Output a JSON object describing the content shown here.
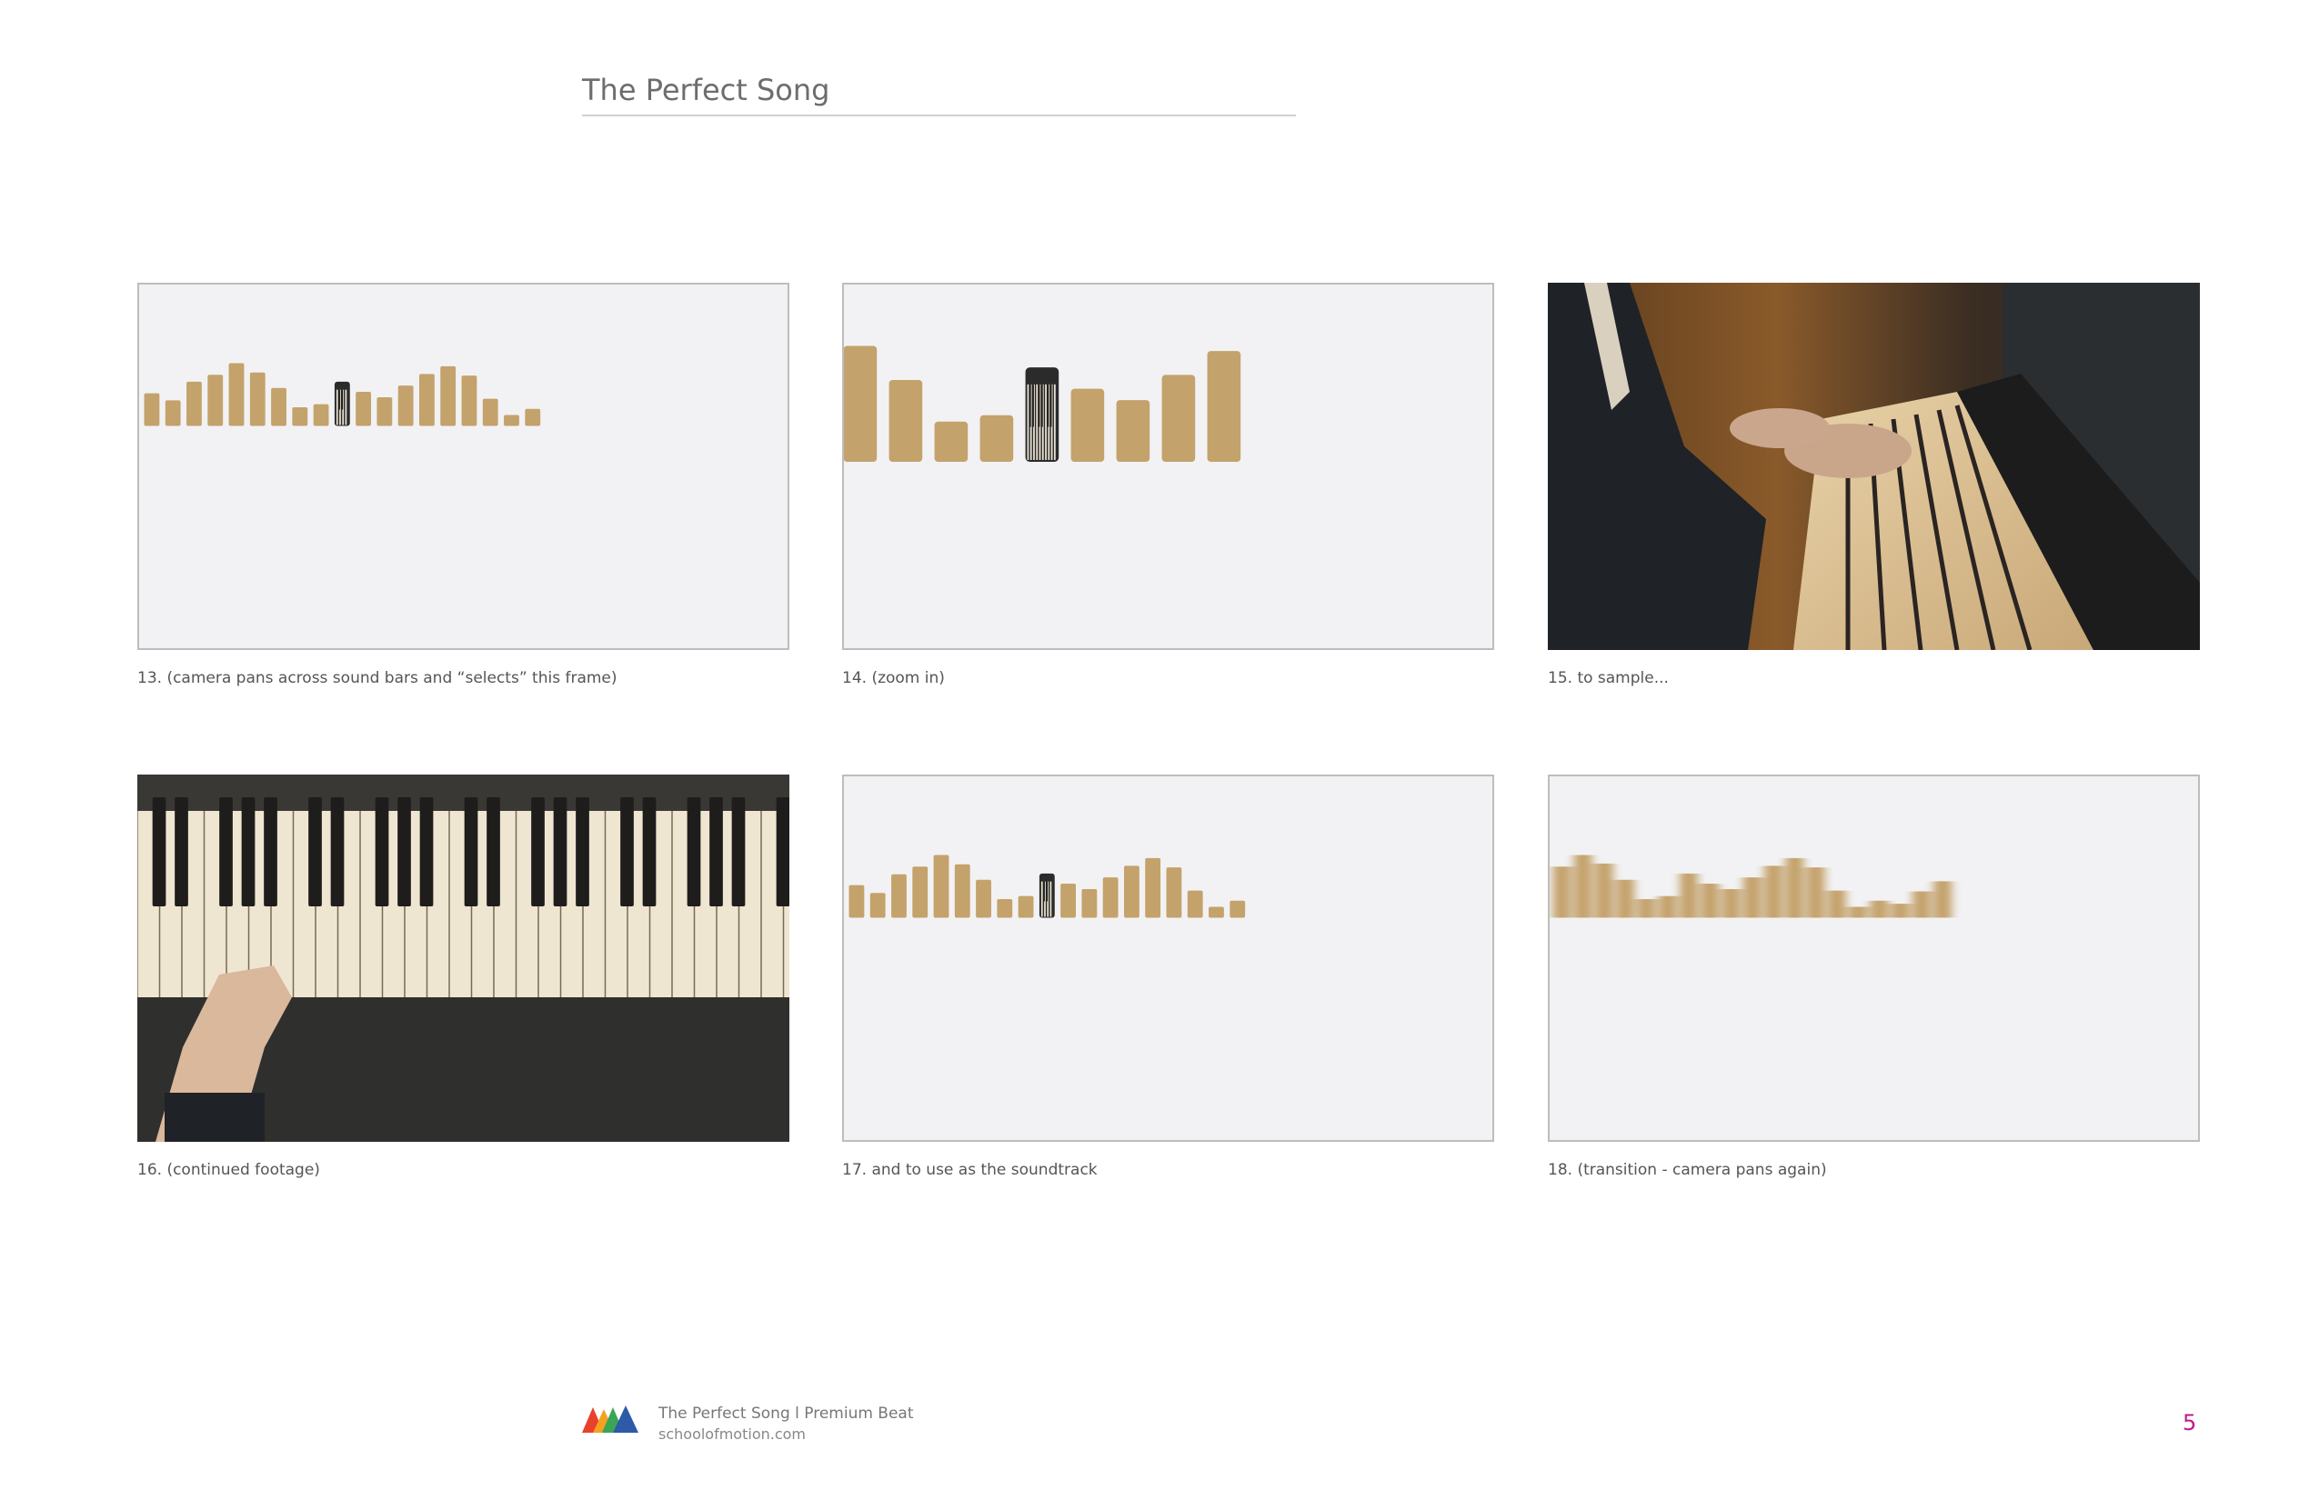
{
  "header": {
    "title": "The Perfect Song"
  },
  "colors": {
    "bar": "#c4a26c",
    "panel": "#f2f2f4",
    "accent_page": "#c2188c"
  },
  "frames": [
    {
      "caption": "13. (camera pans across sound bars and “selects” this frame)",
      "bars": [
        0.42,
        0.33,
        0.57,
        0.66,
        0.81,
        0.69,
        0.49,
        0.24,
        0.28,
        0.57,
        0.44,
        0.37,
        0.52,
        0.67,
        0.77,
        0.65,
        0.35,
        0.14,
        0.22
      ],
      "highlight": 9
    },
    {
      "caption": "14. (zoom in)",
      "bars": [
        0.92,
        0.65,
        0.32,
        0.37,
        0.75,
        0.58,
        0.49,
        0.69,
        0.88
      ],
      "highlight": 4
    },
    {
      "caption": "15. to sample..."
    },
    {
      "caption": "16. (continued footage)"
    },
    {
      "caption": "17. and to use as the soundtrack",
      "bars": [
        0.42,
        0.32,
        0.56,
        0.66,
        0.81,
        0.69,
        0.49,
        0.24,
        0.28,
        0.57,
        0.44,
        0.37,
        0.52,
        0.67,
        0.77,
        0.65,
        0.35,
        0.14,
        0.22
      ],
      "highlight": 9
    },
    {
      "caption": "18. (transition - camera pans again)",
      "bars": [
        0.66,
        0.81,
        0.7,
        0.49,
        0.24,
        0.28,
        0.57,
        0.44,
        0.37,
        0.52,
        0.67,
        0.77,
        0.65,
        0.35,
        0.14,
        0.22,
        0.18,
        0.34,
        0.47
      ]
    }
  ],
  "footer": {
    "title": "The Perfect Song l  Premium Beat",
    "url": "schoolofmotion.com",
    "page": "5"
  }
}
